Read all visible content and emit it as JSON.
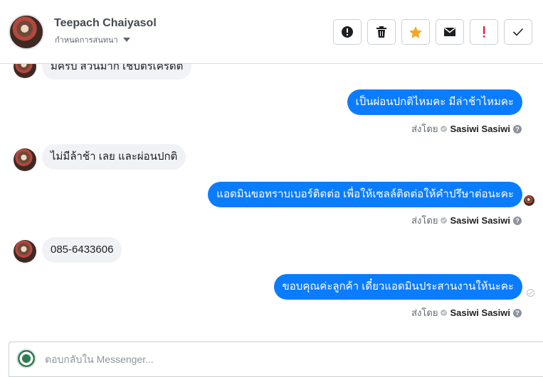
{
  "header": {
    "contact_name": "Teepach Chaiyasol",
    "status_label": "กำหนดการสนทนา",
    "actions": [
      {
        "name": "report-button",
        "icon": "exclamation-circle-icon"
      },
      {
        "name": "delete-button",
        "icon": "trash-icon"
      },
      {
        "name": "star-button",
        "icon": "star-icon",
        "color": "#f5a623"
      },
      {
        "name": "mark-unread-button",
        "icon": "envelope-icon"
      },
      {
        "name": "flag-important-button",
        "icon": "exclamation-icon",
        "color": "#e41e3f"
      },
      {
        "name": "mark-done-button",
        "icon": "check-icon"
      }
    ]
  },
  "messages": [
    {
      "direction": "in",
      "text": "มีครับ สวนมาก เชบตรเครดต"
    },
    {
      "direction": "out",
      "text": "เป็นผ่อนปกติไหมคะ มีล่าช้าไหมคะ",
      "sent_by_label": "ส่งโดย",
      "sent_by_name": "Sasiwi Sasiwi"
    },
    {
      "direction": "in",
      "text": "ไม่มีล้าช้า เลย และผ่อนปกติ"
    },
    {
      "direction": "out",
      "text": "แอดมินขอทราบเบอร์ติดต่อ เพื่อให้เซลล์ติดต่อให้คำปรึษาต่อนะคะ",
      "sent_by_label": "ส่งโดย",
      "sent_by_name": "Sasiwi Sasiwi"
    },
    {
      "direction": "in",
      "text": "085-6433606"
    },
    {
      "direction": "out",
      "text": "ขอบคุณค่ะลูกค้า เดี๋ยวแอดมินประสานงานให้นะคะ",
      "sent_by_label": "ส่งโดย",
      "sent_by_name": "Sasiwi Sasiwi"
    }
  ],
  "composer": {
    "placeholder": "ตอบกลับใน Messenger..."
  },
  "colors": {
    "outgoing_bubble": "#0a7cff",
    "incoming_bubble": "#f0f2f5"
  }
}
